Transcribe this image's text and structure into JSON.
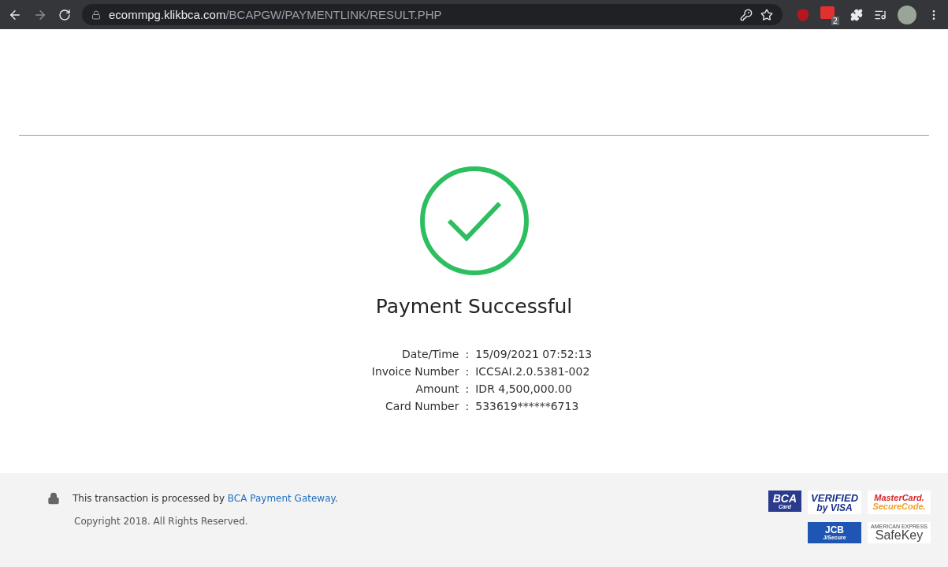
{
  "browser": {
    "url_host": "ecommpg.klikbca.com",
    "url_path": "/BCAPGW/PAYMENTLINK/RESULT.PHP",
    "extension_badge": "2"
  },
  "result": {
    "title": "Payment Successful",
    "success": true,
    "details": [
      {
        "label": "Date/Time",
        "separator": ":",
        "value": "15/09/2021 07:52:13"
      },
      {
        "label": "Invoice Number",
        "separator": ":",
        "value": "ICCSAI.2.0.5381-002"
      },
      {
        "label": "Amount",
        "separator": ":",
        "value": "IDR 4,500,000.00"
      },
      {
        "label": "Card Number",
        "separator": ":",
        "value": "533619******6713"
      }
    ]
  },
  "footer": {
    "notice": "This transaction is processed by ",
    "link": "BCA Payment Gateway",
    "notice_end": ".",
    "copyright": "Copyright 2018. All Rights Reserved.",
    "logos": [
      {
        "kind": "bca",
        "lines": [
          "BCA",
          "Card"
        ]
      },
      {
        "kind": "visa",
        "lines": [
          "VERIFIED",
          "by VISA"
        ]
      },
      {
        "kind": "mastercard",
        "lines": [
          "MasterCard.",
          "SecureCode."
        ]
      },
      {
        "kind": "jcb",
        "lines": [
          "JCB",
          "J/Secure"
        ]
      },
      {
        "kind": "amex",
        "lines": [
          "AMERICAN EXPRESS",
          "SafeKey"
        ]
      }
    ]
  }
}
